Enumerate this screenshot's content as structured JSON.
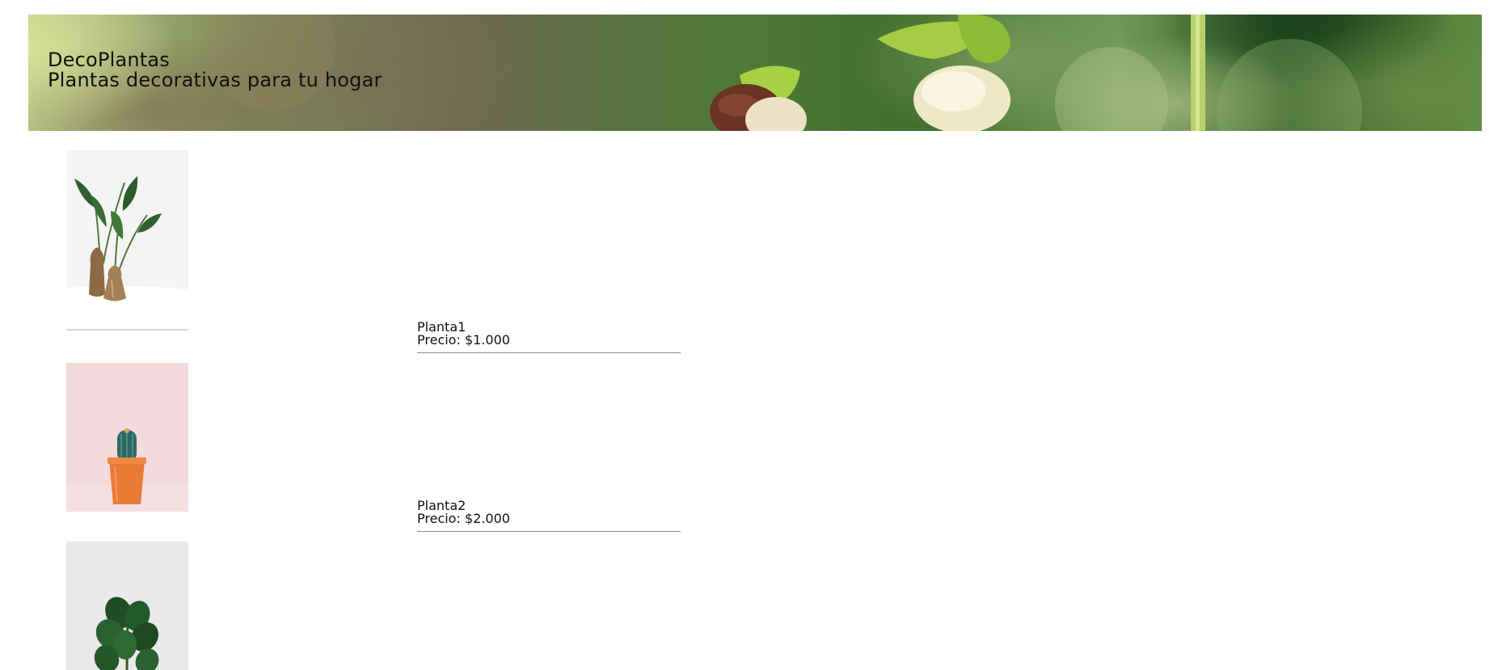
{
  "header": {
    "brand": "DecoPlantas",
    "tagline": "Plantas decorativas para tu hogar"
  },
  "products": [
    {
      "name": "Planta1",
      "price": "Precio: $1.000",
      "image": "potted-leaves-photo"
    },
    {
      "name": "Planta2",
      "price": "Precio: $2.000",
      "image": "cactus-photo"
    },
    {
      "image": "fiddle-leaf-fig-photo"
    }
  ],
  "colors": {
    "text": "#111111",
    "divider": "#8a8a8a",
    "banner_green": "#4f7a3a",
    "background": "#ffffff"
  }
}
